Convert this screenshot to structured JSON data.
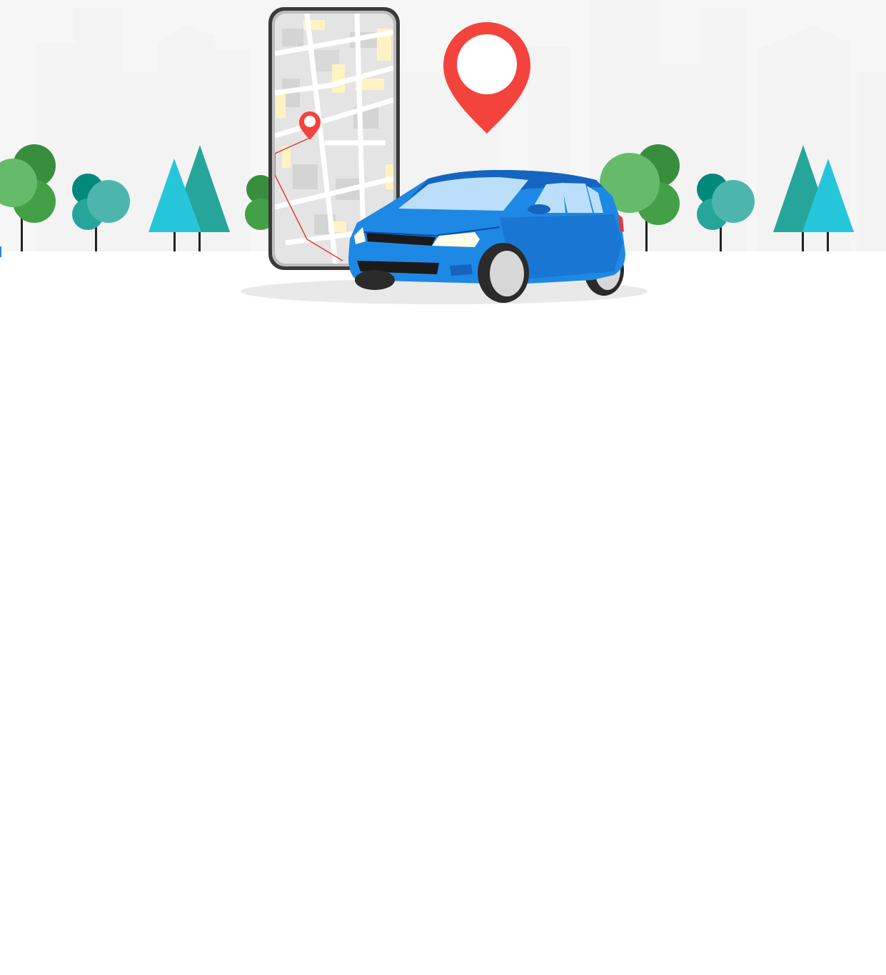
{
  "colors": {
    "background": "#ffffff",
    "skyline": "#f3f3f3",
    "pin_red": "#f4433c",
    "car_blue": "#1e88e5",
    "car_blue_dark": "#1565c0",
    "window_light": "#bbdefb",
    "tree_green_light": "#66bb6a",
    "tree_green_dark": "#388e3c",
    "tree_teal": "#26a69a",
    "tree_teal_light": "#4db6ac",
    "tree_cyan": "#26c6da",
    "map_road": "#ffffff",
    "map_block": "#e3e3e3",
    "map_yellow": "#fff3c4",
    "phone_frame": "#3a3a3a",
    "route_red": "#e53935"
  },
  "icons": {
    "large_pin": "map-pin-icon",
    "phone_pin": "map-pin-icon"
  }
}
